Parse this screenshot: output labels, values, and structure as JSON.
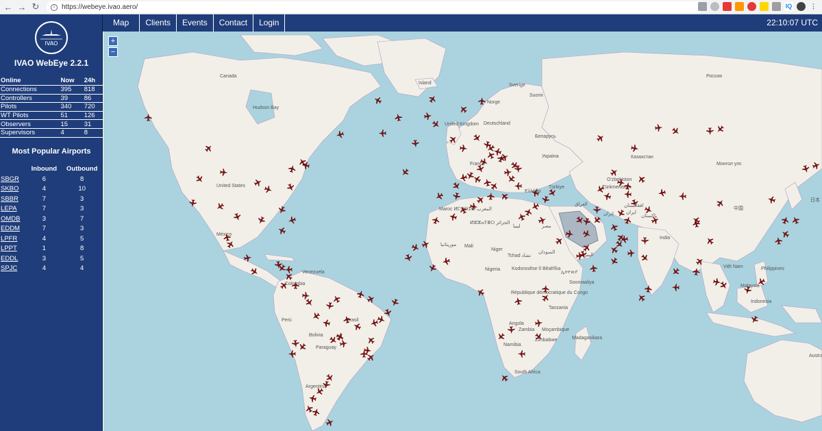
{
  "browser": {
    "url": "https://webeye.ivao.aero/",
    "back_icon": "←",
    "forward_icon": "→",
    "reload_icon": "↻"
  },
  "sidebar": {
    "logo_text": "IVAO",
    "app_title": "IVAO WebEye 2.2.1",
    "online_headers": [
      "Online",
      "Now",
      "24h"
    ],
    "online_rows": [
      {
        "label": "Connections",
        "now": "395",
        "h24": "818"
      },
      {
        "label": "Controllers",
        "now": "39",
        "h24": "86"
      },
      {
        "label": "Pilots",
        "now": "340",
        "h24": "720"
      },
      {
        "label": "WT Pilots",
        "now": "51",
        "h24": "126"
      },
      {
        "label": "Observers",
        "now": "15",
        "h24": "31"
      },
      {
        "label": "Supervisors",
        "now": "4",
        "h24": "8"
      }
    ],
    "popular_title": "Most Popular Airports",
    "airport_headers": [
      "",
      "Inbound",
      "Outbound"
    ],
    "airports": [
      {
        "code": "SBGR",
        "inbound": "6",
        "outbound": "8"
      },
      {
        "code": "SKBO",
        "inbound": "4",
        "outbound": "10"
      },
      {
        "code": "SBBR",
        "inbound": "7",
        "outbound": "3"
      },
      {
        "code": "LEPA",
        "inbound": "7",
        "outbound": "3"
      },
      {
        "code": "OMDB",
        "inbound": "3",
        "outbound": "7"
      },
      {
        "code": "EDDM",
        "inbound": "7",
        "outbound": "3"
      },
      {
        "code": "LPFR",
        "inbound": "4",
        "outbound": "5"
      },
      {
        "code": "LPPT",
        "inbound": "1",
        "outbound": "8"
      },
      {
        "code": "EDDL",
        "inbound": "3",
        "outbound": "5"
      },
      {
        "code": "SPJC",
        "inbound": "4",
        "outbound": "4"
      }
    ]
  },
  "topnav": {
    "items": [
      "Map",
      "Clients",
      "Events",
      "Contact",
      "Login"
    ],
    "clock": "22:10:07 UTC"
  },
  "map": {
    "zoom_in": "+",
    "zoom_out": "−",
    "colors": {
      "ocean": "#aad3df",
      "land": "#f2efe9",
      "border": "#b49bbf",
      "plane": "#8b0d0d"
    },
    "labels": [
      "Canada",
      "Hudson Bay",
      "United States",
      "Island",
      "Sverige",
      "Suomi",
      "Norge",
      "United Kingdom",
      "Deutschland",
      "France",
      "Беларусь",
      "Україна",
      "Россия",
      "Казахстан",
      "Монгол улс",
      "Türkiye",
      "Ελλάδα",
      "O'zbekiston",
      "Türkmenistan",
      "中国",
      "日本",
      "India",
      "Maroc ⵍⵎⵖⵔⵉⴱ المغرب",
      "ⵍⵣⵣⴰⵢⴻⵔ الجزائر",
      "ليبيا",
      "مصر",
      "Mali",
      "Niger",
      "Tchad تشاد",
      "السودان",
      "Nigeria",
      "Venezuela",
      "Colombia",
      "Perú",
      "Brasil",
      "Bolivia",
      "Paraguay",
      "Argentina",
      "Kodorosêse tî Bêafrîka",
      "République démocratique du Congo",
      "Tanzania",
      "Angola",
      "Zambia",
      "Moçambique",
      "Zimbabwe",
      "Namibia",
      "South Africa",
      "Madagasikara",
      "Soomaaliya",
      "Việt Nam",
      "Philippines",
      "Malaysia",
      "Indonesia",
      "Australia",
      "México",
      "اليمن",
      "إيران",
      "العراق",
      "ايران",
      "ኢትዮጵያ",
      "موريتانيا",
      "پاکستان",
      "افغانستان"
    ]
  }
}
